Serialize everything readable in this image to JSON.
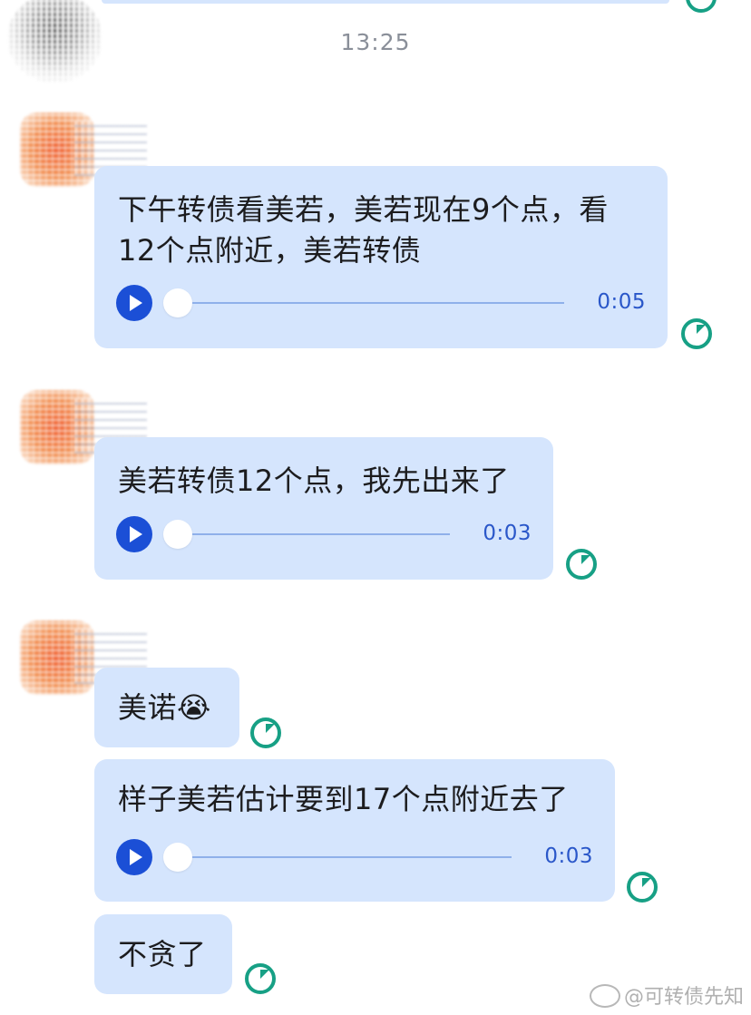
{
  "timestamp": "13:25",
  "messages": [
    {
      "text": "下午转债看美若，美若现在9个点，看12个点附近，美若转债",
      "voice_duration": "0:05"
    },
    {
      "text": "美若转债12个点，我先出来了",
      "voice_duration": "0:03"
    },
    {
      "text": "美诺😭"
    },
    {
      "text": "样子美若估计要到17个点附近去了",
      "voice_duration": "0:03"
    },
    {
      "text": "不贪了"
    }
  ],
  "watermark": "@可转债先知",
  "colors": {
    "bubble": "#d5e5fd",
    "play_button": "#1b4fd6",
    "status_clock": "#17a085"
  }
}
